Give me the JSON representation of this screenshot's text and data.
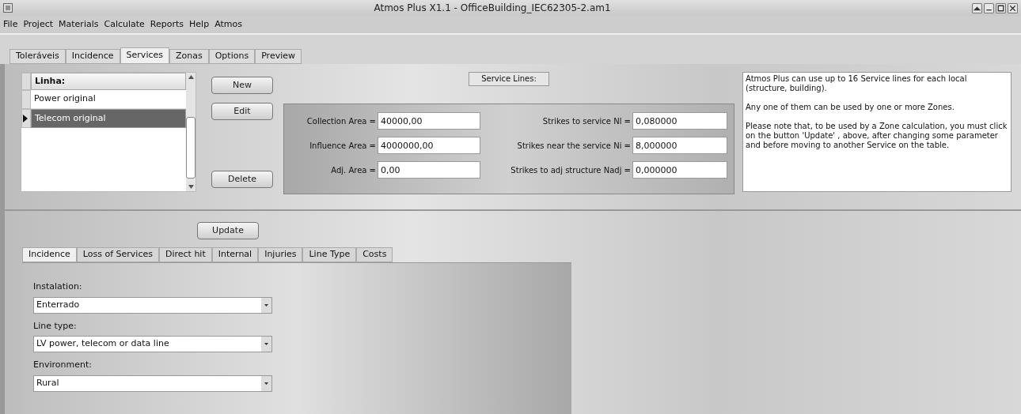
{
  "window": {
    "title": "Atmos Plus X1.1 - OfficeBuilding_IEC62305-2.am1"
  },
  "menu": [
    "File",
    "Project",
    "Materials",
    "Calculate",
    "Reports",
    "Help",
    "Atmos"
  ],
  "tabs": [
    {
      "label": "Toleráveis",
      "selected": false
    },
    {
      "label": "Incidence",
      "selected": false
    },
    {
      "label": "Services",
      "selected": true
    },
    {
      "label": "Zonas",
      "selected": false
    },
    {
      "label": "Options",
      "selected": false
    },
    {
      "label": "Preview",
      "selected": false
    }
  ],
  "service_table": {
    "header": "Linha:",
    "rows": [
      {
        "name": "Power original",
        "selected": false
      },
      {
        "name": "Telecom original",
        "selected": true
      }
    ]
  },
  "buttons": {
    "new": "New",
    "edit": "Edit",
    "delete": "Delete",
    "update": "Update"
  },
  "service_lines_label": "Service Lines:",
  "fields_left": [
    {
      "label": "Collection Area =",
      "value": "40000,00"
    },
    {
      "label": "Influence Area =",
      "value": "4000000,00"
    },
    {
      "label": "Adj. Area =",
      "value": "0,00"
    }
  ],
  "fields_right": [
    {
      "label": "Strikes to service Nl =",
      "value": "0,080000"
    },
    {
      "label": "Strikes near the service Ni =",
      "value": "8,000000"
    },
    {
      "label": "Strikes to adj structure Nadj =",
      "value": "0,000000"
    }
  ],
  "info": [
    "Atmos Plus can use up to 16 Service lines for each local (structure, building).",
    "Any one of them can be used by one or more Zones.",
    "Please note that, to be used by a Zone calculation, you must click on the button 'Update' , above, after changing some parameter and before moving to another Service on the table."
  ],
  "sub_tabs": [
    {
      "label": "Incidence",
      "selected": true
    },
    {
      "label": "Loss of Services",
      "selected": false
    },
    {
      "label": "Direct hit",
      "selected": false
    },
    {
      "label": "Internal",
      "selected": false
    },
    {
      "label": "Injuries",
      "selected": false
    },
    {
      "label": "Line Type",
      "selected": false
    },
    {
      "label": "Costs",
      "selected": false
    }
  ],
  "dropdowns": [
    {
      "label": "Instalation:",
      "value": "Enterrado"
    },
    {
      "label": "Line type:",
      "value": "LV power, telecom or data line"
    },
    {
      "label": "Environment:",
      "value": "Rural"
    }
  ]
}
